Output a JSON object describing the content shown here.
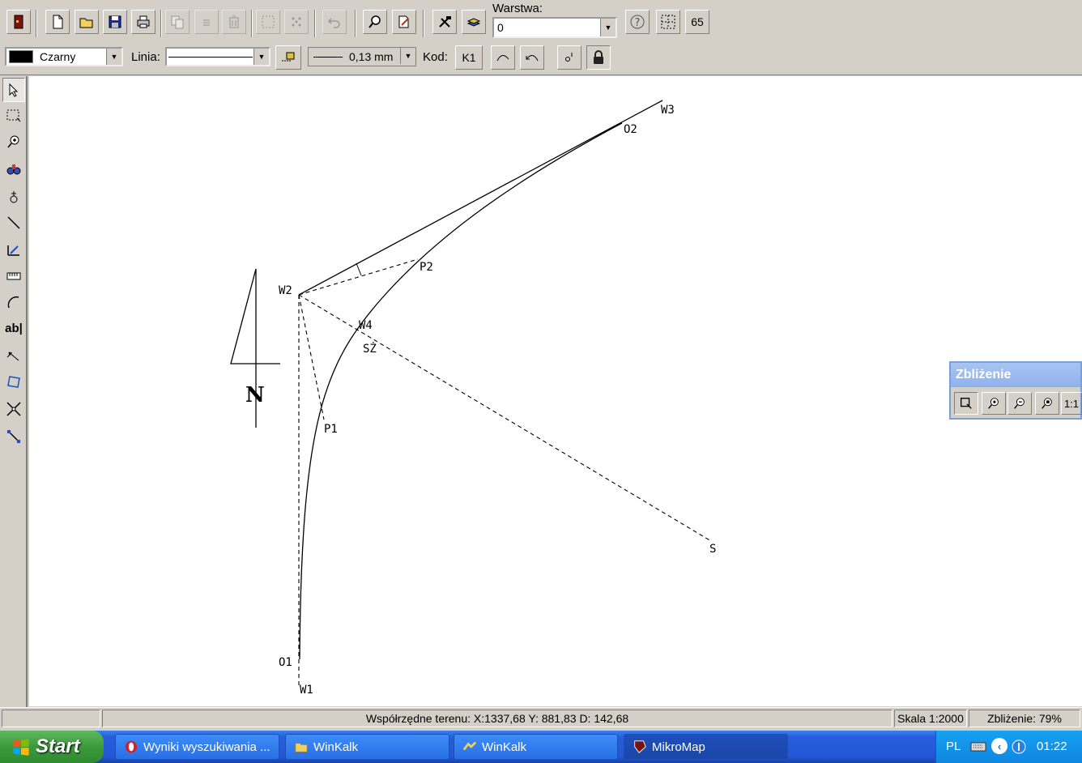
{
  "toolbar": {
    "layer_label": "Warstwa:",
    "layer_value": "0",
    "counter": "65",
    "color_value": "Czarny",
    "color_swatch": "#000000",
    "line_label": "Linia:",
    "thickness_value": "0,13 mm",
    "code_label": "Kod:",
    "code_value": "K1"
  },
  "canvas": {
    "labels": [
      "W3",
      "O2",
      "P2",
      "W2",
      "W4",
      "SŻ",
      "P1",
      "O1",
      "W1",
      "S",
      "N"
    ]
  },
  "zoom_panel": {
    "title": "Zbliżenie",
    "one_to_one": "1:1"
  },
  "status": {
    "coordinates": "Współrzędne terenu: X:1337,68 Y: 881,83  D: 142,68",
    "scale": "Skala 1:2000",
    "zoom": "Zbliżenie: 79%"
  },
  "taskbar": {
    "start": "Start",
    "tasks": [
      "Wyniki wyszukiwania ...",
      "WinKalk",
      "WinKalk",
      "MikroMap"
    ],
    "lang": "PL",
    "time": "01:22"
  }
}
